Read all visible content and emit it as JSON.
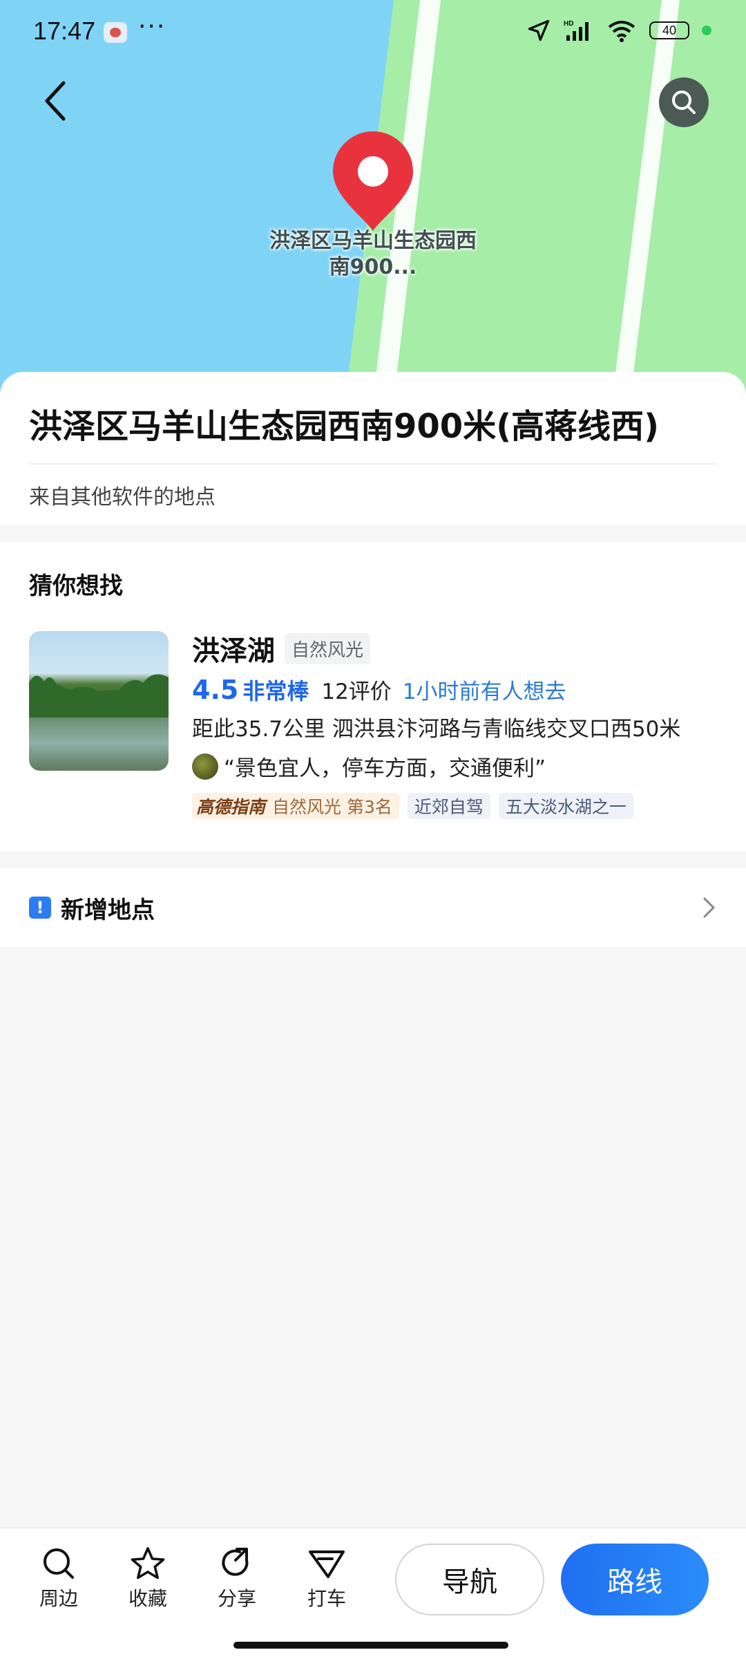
{
  "status_bar": {
    "time": "17:47",
    "dots": "···",
    "battery": "40"
  },
  "map": {
    "marker_label": "洪泽区马羊山生态园西南900..."
  },
  "place": {
    "title": "洪泽区马羊山生态园西南900米(高蒋线西)",
    "source": "来自其他软件的地点"
  },
  "guess": {
    "title": "猜你想找",
    "poi": {
      "name": "洪泽湖",
      "category": "自然风光",
      "score": "4.5",
      "score_word": "非常棒",
      "reviews": "12评价",
      "recent": "1小时前有人想去",
      "address": "距此35.7公里  泗洪县汴河路与青临线交叉口西50米",
      "quote": "“景色宜人，停车方面，交通便利”",
      "rank_brand": "高德指南",
      "rank_text": "自然风光  第3名",
      "tags": [
        "近郊自驾",
        "五大淡水湖之一"
      ]
    }
  },
  "add_place": {
    "label": "新增地点"
  },
  "bottom_bar": {
    "actions": [
      "周边",
      "收藏",
      "分享",
      "打车"
    ],
    "navigate": "导航",
    "route": "路线"
  },
  "colors": {
    "accent": "#1e66ec",
    "water": "#7fd4f6",
    "land": "#a6eda8",
    "marker": "#e8333f"
  }
}
